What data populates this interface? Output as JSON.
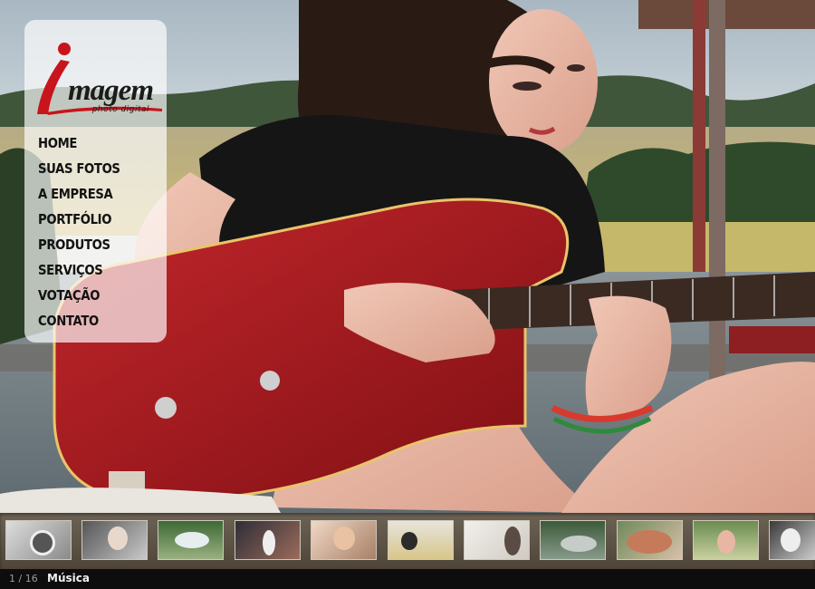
{
  "logo": {
    "word": "magem",
    "subtitle": "photo digital",
    "accent_color": "#c8141c"
  },
  "nav": {
    "items": [
      {
        "label": "HOME"
      },
      {
        "label": "SUAS FOTOS"
      },
      {
        "label": "A EMPRESA"
      },
      {
        "label": "PORTFÓLIO"
      },
      {
        "label": "PRODUTOS"
      },
      {
        "label": "SERVIÇOS"
      },
      {
        "label": "VOTAÇÃO"
      },
      {
        "label": "CONTATO"
      }
    ]
  },
  "slideshow": {
    "current": "1",
    "separator": "/",
    "total": "16",
    "caption": "Música"
  },
  "thumbnails": {
    "count": 11,
    "icons": [
      "photo-thumbnail"
    ]
  }
}
